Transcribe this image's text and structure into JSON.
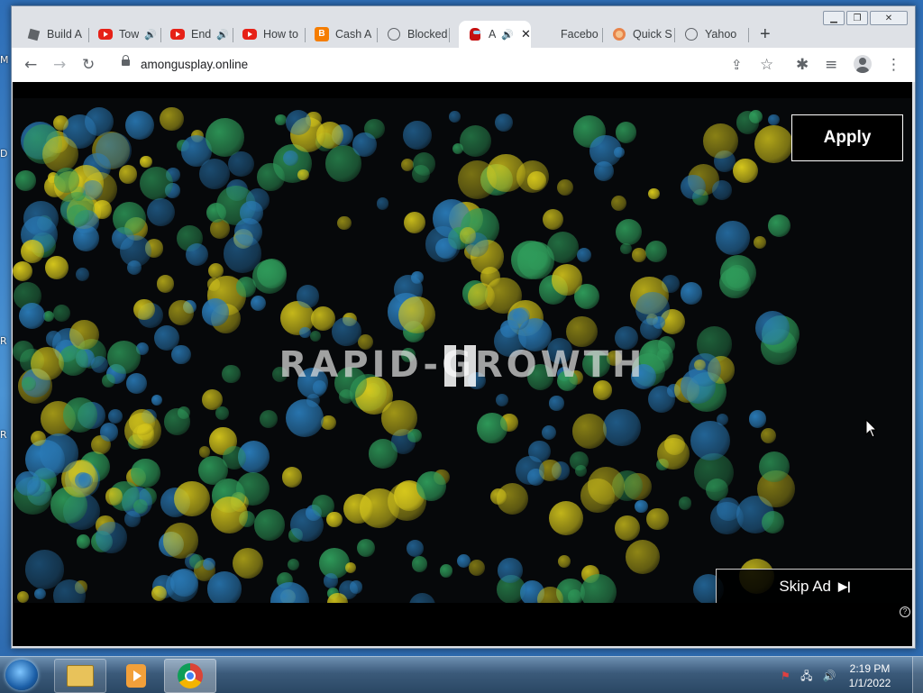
{
  "desktop": {
    "edge_letters": [
      "M",
      "D",
      "R",
      "R"
    ]
  },
  "window": {
    "minimize": "▁",
    "maximize": "❐",
    "close": "✕"
  },
  "tabs": [
    {
      "label": "Build A",
      "icon": "roblox-icon"
    },
    {
      "label": "Tow",
      "icon": "youtube-icon",
      "audio": "🔊"
    },
    {
      "label": "End",
      "icon": "youtube-icon",
      "audio": "🔊"
    },
    {
      "label": "How to",
      "icon": "youtube-icon"
    },
    {
      "label": "Cash A",
      "icon": "blogger-icon"
    },
    {
      "label": "Blocked",
      "icon": "globe-icon"
    },
    {
      "label": "A",
      "icon": "among-us-icon",
      "audio": "🔊",
      "close": "✕",
      "active": true
    },
    {
      "label": "Facebo",
      "icon": "none"
    },
    {
      "label": "Quick S",
      "icon": "quick-icon"
    },
    {
      "label": "Yahoo",
      "icon": "globe-icon"
    }
  ],
  "newtab_label": "+",
  "toolbar": {
    "back": "←",
    "forward": "→",
    "reload": "↻",
    "url": "amongusplay.online",
    "share": "⇪",
    "star": "☆",
    "extensions": "✱",
    "media": "≡",
    "menu": "⋮"
  },
  "ad": {
    "headline": "RAPID-GROWTH",
    "apply_label": "Apply",
    "skip_label": "Skip Ad",
    "skip_icon": "▶|",
    "help_label": "?",
    "colors": {
      "blue": "#2a7bb8",
      "green": "#2f9b5a",
      "yellow": "#d7c81c"
    }
  },
  "taskbar": {
    "apps": [
      "file-explorer-icon",
      "media-player-icon",
      "chrome-icon"
    ],
    "tray_icons": [
      "network-icon",
      "flag-icon",
      "volume-icon"
    ],
    "time": "2:19 PM",
    "date": "1/1/2022"
  }
}
